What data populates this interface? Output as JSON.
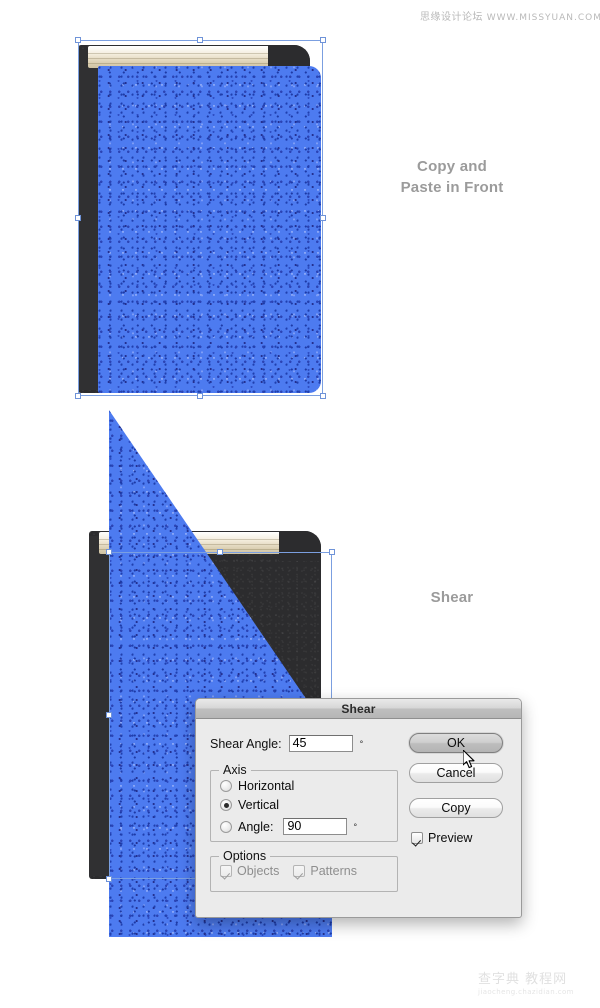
{
  "watermarks": {
    "top_cn": "思缘设计论坛",
    "top_url": "WWW.MISSYUAN.COM",
    "bottom_cn": "查字典 教程网",
    "bottom_url": "jiaocheng.chazidian.com"
  },
  "steps": [
    {
      "id": "copy-paste",
      "label": "Copy and\nPaste in Front"
    },
    {
      "id": "shear",
      "label": "Shear"
    }
  ],
  "captions": {
    "copy_paste": "Copy and Paste in Front",
    "copy_paste_line1": "Copy and",
    "copy_paste_line2": "Paste in Front",
    "shear": "Shear"
  },
  "dialog": {
    "title": "Shear",
    "shear_angle_label": "Shear Angle:",
    "shear_angle_value": "45",
    "degree_symbol": "°",
    "axis": {
      "legend": "Axis",
      "options": [
        {
          "label": "Horizontal",
          "selected": false
        },
        {
          "label": "Vertical",
          "selected": true
        },
        {
          "label": "Angle:",
          "selected": false
        }
      ],
      "angle_value": "90",
      "angle_degree_symbol": "°"
    },
    "options": {
      "legend": "Options",
      "checkboxes": [
        {
          "label": "Objects",
          "checked": true,
          "disabled": true
        },
        {
          "label": "Patterns",
          "checked": true,
          "disabled": true
        }
      ]
    },
    "buttons": {
      "ok": "OK",
      "cancel": "Cancel",
      "copy": "Copy"
    },
    "preview": {
      "label": "Preview",
      "checked": true
    }
  },
  "colors": {
    "cover_blue": "#4d7bf0",
    "cover_dark": "#2c2c2e",
    "pages_cream": "#f3ecdc",
    "selection_blue": "#7b9fe0",
    "caption_gray": "#9b9b9b",
    "dialog_bg": "#ebebeb",
    "canvas_white": "#ffffff"
  },
  "artwork": {
    "top_book": {
      "name": "blue-book-front-cover",
      "selected": true
    },
    "bottom_book": {
      "name": "blue-book-sheared-cover",
      "selected": true
    }
  }
}
